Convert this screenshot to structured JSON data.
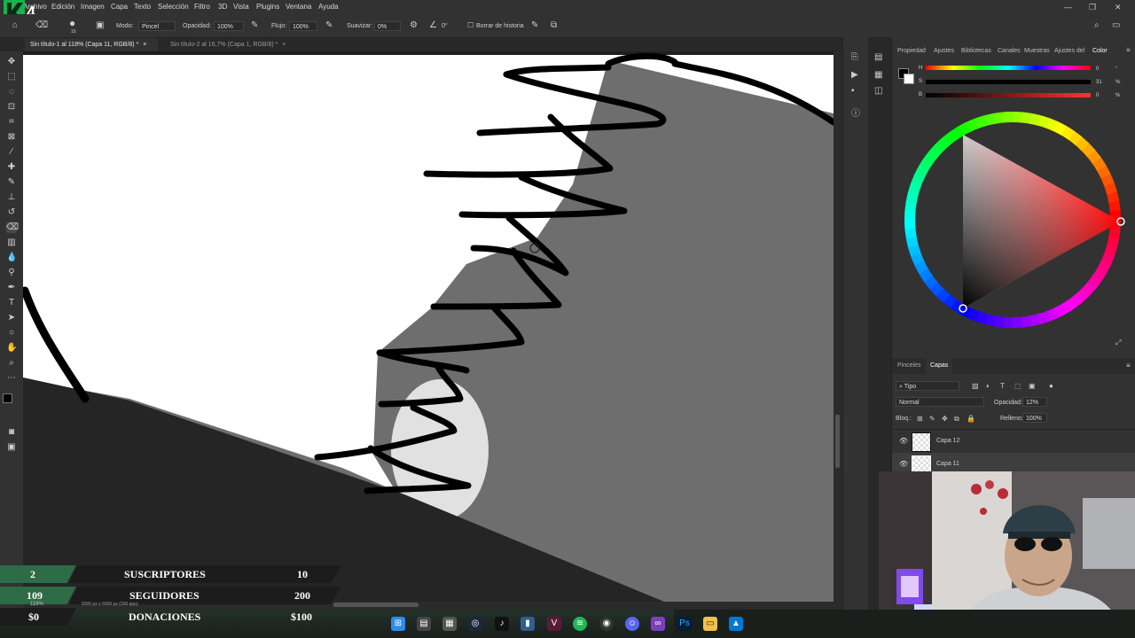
{
  "menubar": {
    "items": [
      "Archivo",
      "Edición",
      "Imagen",
      "Capa",
      "Texto",
      "Selección",
      "Filtro",
      "3D",
      "Vista",
      "Plugins",
      "Ventana",
      "Ayuda"
    ]
  },
  "options": {
    "brush_size": "15",
    "mode_label": "Modo:",
    "mode_value": "Pincel",
    "opacity_label": "Opacidad:",
    "opacity_value": "100%",
    "flow_label": "Flujo:",
    "flow_value": "100%",
    "smooth_label": "Suavizar:",
    "smooth_value": "0%",
    "angle_value": "0°",
    "history_label": "Borrar de historia"
  },
  "tabs": [
    {
      "label": "Sin título-1 al 118% (Capa 11, RGB/8) *",
      "close": "×"
    },
    {
      "label": "Sin título-2 al 16,7% (Capa 1, RGB/8) *",
      "close": "×"
    }
  ],
  "status": {
    "zoom": "118%",
    "doc_size": "5000 px x 5000 px (300 ppp)"
  },
  "panels": {
    "top_tabs": [
      "Propiedad",
      "Ajustes",
      "Bibliotecas",
      "Canales",
      "Muestras",
      "Ajustes del",
      "Color"
    ],
    "color_h_label": "H",
    "color_s_label": "S",
    "color_b_label": "B",
    "color_h_value": "0",
    "color_s_value": "31",
    "color_b_value": "0",
    "pct": "%",
    "deg": "°",
    "layer_tabs": [
      "Pinceles",
      "Capas"
    ],
    "filter_label": "Tipo",
    "blend_mode": "Normal",
    "opacity_label": "Opacidad:",
    "opacity_value": "12%",
    "lock_label": "Bloq.:",
    "fill_label": "Relleno:",
    "fill_value": "100%",
    "layers": [
      "Capa 12",
      "Capa 11"
    ]
  },
  "stats": {
    "row1": {
      "left": "2",
      "label": "SUSCRIPTORES",
      "right": "10"
    },
    "row2": {
      "left": "109",
      "label": "SEGUIDORES",
      "right": "200"
    },
    "row3": {
      "left": "$0",
      "label": "DONACIONES",
      "right": "$100"
    }
  },
  "colors": {
    "ui_bg": "#323232",
    "canvas_gray": "#6e6e6e",
    "stat_green": "#2e6b47",
    "stat_dark": "#1c1c1c",
    "accent": "#2d8ceb"
  },
  "taskbar_icons": [
    "windows-icon",
    "file-icon",
    "store-icon",
    "steam-icon",
    "tiktok-icon",
    "app-icon",
    "vegas-icon",
    "spotify-icon",
    "github-icon",
    "discord-icon",
    "visual-studio-icon",
    "photoshop-icon",
    "folder-icon",
    "azure-icon"
  ]
}
